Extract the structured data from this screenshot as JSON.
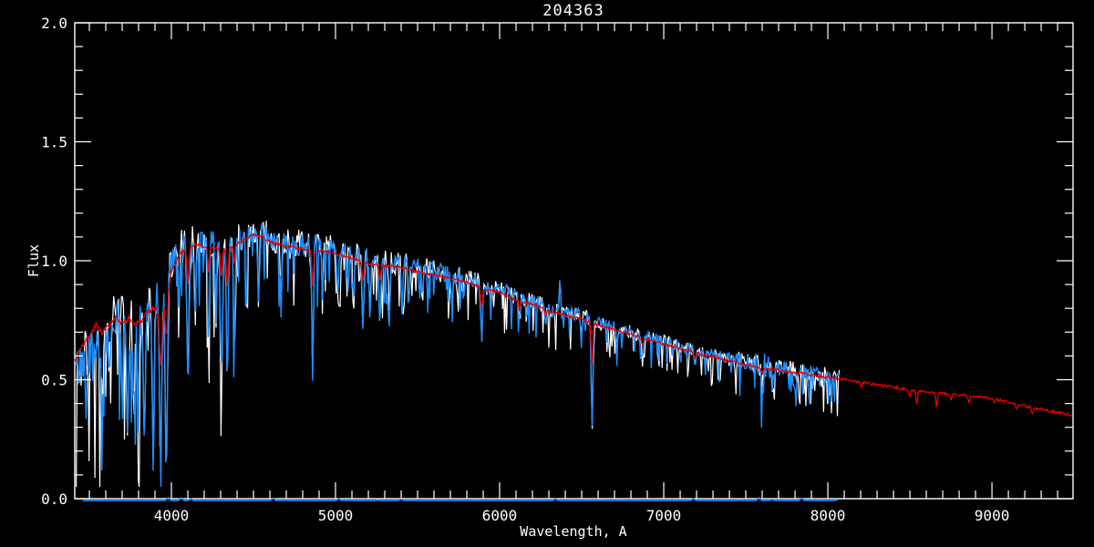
{
  "page": {
    "background": "#000000",
    "foreground": "#ffffff"
  },
  "chart_data": {
    "type": "line",
    "title": "204363",
    "xlabel": "Wavelength, A",
    "ylabel": "Flux",
    "xlim": [
      3411,
      9494
    ],
    "ylim": [
      0.0,
      2.0
    ],
    "grid": false,
    "axis_color": "#ffffff",
    "x_major_ticks": [
      {
        "value": 4000,
        "label": "4000"
      },
      {
        "value": 5000,
        "label": "5000"
      },
      {
        "value": 6000,
        "label": "6000"
      },
      {
        "value": 7000,
        "label": "7000"
      },
      {
        "value": 8000,
        "label": "8000"
      },
      {
        "value": 9000,
        "label": "9000"
      }
    ],
    "y_major_ticks": [
      {
        "value": 0.0,
        "label": "0.0"
      },
      {
        "value": 0.5,
        "label": "0.5"
      },
      {
        "value": 1.0,
        "label": "1.0"
      },
      {
        "value": 1.5,
        "label": "1.5"
      },
      {
        "value": 2.0,
        "label": "2.0"
      }
    ],
    "x_minor_step": 100,
    "y_minor_step": 0.1,
    "observed": {
      "color": "#1e8fff",
      "underlay_color": "#ffffff",
      "range": [
        3420,
        8070
      ],
      "continuum": [
        [
          3420,
          0.54
        ],
        [
          3450,
          0.56
        ],
        [
          3500,
          0.62
        ],
        [
          3550,
          0.66
        ],
        [
          3600,
          0.7
        ],
        [
          3650,
          0.74
        ],
        [
          3700,
          0.73
        ],
        [
          3750,
          0.75
        ],
        [
          3800,
          0.74
        ],
        [
          3850,
          0.8
        ],
        [
          3900,
          0.83
        ],
        [
          3950,
          0.85
        ],
        [
          4000,
          0.98
        ],
        [
          4050,
          1.05
        ],
        [
          4100,
          1.07
        ],
        [
          4150,
          1.09
        ],
        [
          4200,
          1.08
        ],
        [
          4250,
          1.07
        ],
        [
          4300,
          1.08
        ],
        [
          4350,
          1.07
        ],
        [
          4400,
          1.09
        ],
        [
          4450,
          1.11
        ],
        [
          4500,
          1.13
        ],
        [
          4550,
          1.12
        ],
        [
          4600,
          1.1
        ],
        [
          4700,
          1.08
        ],
        [
          4800,
          1.07
        ],
        [
          4900,
          1.06
        ],
        [
          5000,
          1.05
        ],
        [
          5100,
          1.03
        ],
        [
          5200,
          1.01
        ],
        [
          5300,
          1.0
        ],
        [
          5400,
          0.99
        ],
        [
          5500,
          0.97
        ],
        [
          5600,
          0.96
        ],
        [
          5700,
          0.94
        ],
        [
          5800,
          0.93
        ],
        [
          5900,
          0.9
        ],
        [
          6000,
          0.88
        ],
        [
          6100,
          0.85
        ],
        [
          6200,
          0.83
        ],
        [
          6300,
          0.8
        ],
        [
          6400,
          0.78
        ],
        [
          6500,
          0.77
        ],
        [
          6600,
          0.74
        ],
        [
          6700,
          0.72
        ],
        [
          6800,
          0.7
        ],
        [
          6900,
          0.68
        ],
        [
          7000,
          0.66
        ],
        [
          7100,
          0.64
        ],
        [
          7200,
          0.62
        ],
        [
          7300,
          0.605
        ],
        [
          7400,
          0.59
        ],
        [
          7500,
          0.575
        ],
        [
          7600,
          0.56
        ],
        [
          7700,
          0.55
        ],
        [
          7800,
          0.54
        ],
        [
          7900,
          0.53
        ],
        [
          8000,
          0.52
        ],
        [
          8070,
          0.515
        ]
      ],
      "absorption_lines": [
        [
          3580,
          12,
          0.35
        ],
        [
          3620,
          8,
          0.3
        ],
        [
          3735,
          10,
          0.6
        ],
        [
          3770,
          8,
          0.55
        ],
        [
          3798,
          8,
          0.5
        ],
        [
          3835,
          8,
          0.72
        ],
        [
          3889,
          8,
          0.78
        ],
        [
          3934,
          10,
          0.85
        ],
        [
          3969,
          10,
          0.8
        ],
        [
          4045,
          6,
          0.3
        ],
        [
          4101,
          9,
          0.55
        ],
        [
          4144,
          6,
          0.3
        ],
        [
          4227,
          6,
          0.45
        ],
        [
          4271,
          6,
          0.35
        ],
        [
          4305,
          10,
          0.5
        ],
        [
          4340,
          8,
          0.55
        ],
        [
          4383,
          7,
          0.45
        ],
        [
          4455,
          6,
          0.3
        ],
        [
          4531,
          6,
          0.3
        ],
        [
          4668,
          6,
          0.3
        ],
        [
          4861,
          7,
          0.55
        ],
        [
          4920,
          6,
          0.25
        ],
        [
          5015,
          6,
          0.2
        ],
        [
          5110,
          6,
          0.2
        ],
        [
          5167,
          8,
          0.32
        ],
        [
          5210,
          6,
          0.25
        ],
        [
          5270,
          8,
          0.3
        ],
        [
          5328,
          6,
          0.25
        ],
        [
          5404,
          6,
          0.2
        ],
        [
          5446,
          6,
          0.2
        ],
        [
          5530,
          6,
          0.15
        ],
        [
          5711,
          6,
          0.12
        ],
        [
          5782,
          6,
          0.1
        ],
        [
          5890,
          9,
          0.25
        ],
        [
          6122,
          6,
          0.12
        ],
        [
          6162,
          6,
          0.12
        ],
        [
          6280,
          6,
          0.1
        ],
        [
          6495,
          6,
          0.12
        ],
        [
          6563,
          7,
          0.62
        ],
        [
          6717,
          6,
          0.1
        ],
        [
          6870,
          9,
          0.15
        ],
        [
          7190,
          8,
          0.08
        ],
        [
          7600,
          10,
          0.18
        ],
        [
          7665,
          8,
          0.12
        ]
      ],
      "cosmic_spikes": [
        [
          6368,
          4,
          -0.26
        ],
        [
          7612,
          4,
          -0.16
        ]
      ],
      "noise_profile": [
        [
          3420,
          0.105
        ],
        [
          3550,
          0.095
        ],
        [
          3700,
          0.1
        ],
        [
          3850,
          0.1
        ],
        [
          3950,
          0.09
        ],
        [
          4050,
          0.07
        ],
        [
          4200,
          0.06
        ],
        [
          4400,
          0.055
        ],
        [
          4600,
          0.05
        ],
        [
          4800,
          0.05
        ],
        [
          5000,
          0.045
        ],
        [
          5200,
          0.042
        ],
        [
          5400,
          0.04
        ],
        [
          5600,
          0.038
        ],
        [
          5800,
          0.035
        ],
        [
          6000,
          0.032
        ],
        [
          6200,
          0.03
        ],
        [
          6400,
          0.028
        ],
        [
          6600,
          0.027
        ],
        [
          6800,
          0.026
        ],
        [
          7000,
          0.025
        ],
        [
          7200,
          0.024
        ],
        [
          7400,
          0.024
        ],
        [
          7520,
          0.04
        ],
        [
          7620,
          0.05
        ],
        [
          7680,
          0.035
        ],
        [
          7800,
          0.028
        ],
        [
          7950,
          0.03
        ],
        [
          8070,
          0.035
        ]
      ],
      "down_spike_probability": 0.15,
      "seeds": {
        "white": 7,
        "blue": 42
      },
      "underlay_noise_scale": 1.2
    },
    "model": {
      "color": "#e60000",
      "range": [
        3411,
        9490
      ],
      "anchors": [
        [
          3411,
          0.58
        ],
        [
          3450,
          0.64
        ],
        [
          3500,
          0.68
        ],
        [
          3540,
          0.73
        ],
        [
          3580,
          0.7
        ],
        [
          3620,
          0.73
        ],
        [
          3660,
          0.76
        ],
        [
          3700,
          0.73
        ],
        [
          3740,
          0.76
        ],
        [
          3780,
          0.73
        ],
        [
          3820,
          0.75
        ],
        [
          3860,
          0.78
        ],
        [
          3900,
          0.8
        ],
        [
          3950,
          0.82
        ],
        [
          4000,
          0.95
        ],
        [
          4050,
          1.03
        ],
        [
          4100,
          1.05
        ],
        [
          4150,
          1.07
        ],
        [
          4200,
          1.06
        ],
        [
          4250,
          1.05
        ],
        [
          4300,
          1.06
        ],
        [
          4350,
          1.05
        ],
        [
          4400,
          1.07
        ],
        [
          4450,
          1.09
        ],
        [
          4500,
          1.11
        ],
        [
          4550,
          1.1
        ],
        [
          4600,
          1.08
        ],
        [
          4700,
          1.06
        ],
        [
          4800,
          1.05
        ],
        [
          4900,
          1.04
        ],
        [
          5000,
          1.03
        ],
        [
          5100,
          1.01
        ],
        [
          5200,
          0.99
        ],
        [
          5300,
          0.98
        ],
        [
          5400,
          0.97
        ],
        [
          5500,
          0.955
        ],
        [
          5600,
          0.94
        ],
        [
          5700,
          0.925
        ],
        [
          5800,
          0.91
        ],
        [
          5900,
          0.885
        ],
        [
          6000,
          0.865
        ],
        [
          6100,
          0.835
        ],
        [
          6200,
          0.815
        ],
        [
          6300,
          0.79
        ],
        [
          6400,
          0.77
        ],
        [
          6500,
          0.755
        ],
        [
          6600,
          0.73
        ],
        [
          6700,
          0.71
        ],
        [
          6800,
          0.69
        ],
        [
          6900,
          0.67
        ],
        [
          7000,
          0.65
        ],
        [
          7100,
          0.63
        ],
        [
          7200,
          0.61
        ],
        [
          7300,
          0.595
        ],
        [
          7400,
          0.58
        ],
        [
          7500,
          0.565
        ],
        [
          7600,
          0.55
        ],
        [
          7700,
          0.54
        ],
        [
          7800,
          0.53
        ],
        [
          7900,
          0.52
        ],
        [
          8000,
          0.51
        ],
        [
          8100,
          0.5
        ],
        [
          8200,
          0.49
        ],
        [
          8300,
          0.478
        ],
        [
          8400,
          0.468
        ],
        [
          8500,
          0.458
        ],
        [
          8600,
          0.45
        ],
        [
          8700,
          0.442
        ],
        [
          8800,
          0.436
        ],
        [
          8900,
          0.43
        ],
        [
          9000,
          0.42
        ],
        [
          9100,
          0.405
        ],
        [
          9200,
          0.39
        ],
        [
          9300,
          0.375
        ],
        [
          9400,
          0.362
        ],
        [
          9490,
          0.35
        ]
      ],
      "absorption_lines": [
        [
          3935,
          12,
          0.3
        ],
        [
          3970,
          10,
          0.22
        ],
        [
          4101,
          8,
          0.14
        ],
        [
          4227,
          6,
          0.1
        ],
        [
          4305,
          9,
          0.12
        ],
        [
          4340,
          8,
          0.15
        ],
        [
          4383,
          6,
          0.08
        ],
        [
          4861,
          7,
          0.14
        ],
        [
          5167,
          8,
          0.08
        ],
        [
          5270,
          7,
          0.06
        ],
        [
          5890,
          8,
          0.1
        ],
        [
          6122,
          6,
          0.05
        ],
        [
          6280,
          6,
          0.04
        ],
        [
          6563,
          7,
          0.25
        ],
        [
          6870,
          8,
          0.05
        ],
        [
          7190,
          7,
          0.04
        ],
        [
          7600,
          8,
          0.05
        ],
        [
          8205,
          7,
          0.05
        ],
        [
          8498,
          6,
          0.07
        ],
        [
          8542,
          6,
          0.14
        ],
        [
          8662,
          6,
          0.14
        ],
        [
          8750,
          6,
          0.05
        ],
        [
          8860,
          7,
          0.06
        ],
        [
          9015,
          7,
          0.05
        ],
        [
          9150,
          8,
          0.04
        ],
        [
          9245,
          7,
          0.06
        ]
      ],
      "wiggle_amp_blue_end": 0.012,
      "wiggle_amp": 0.006,
      "seed": 3
    },
    "noise_floor": {
      "color": "#1e8fff",
      "range": [
        3460,
        8070
      ],
      "flux": -0.008,
      "seed": 9
    }
  }
}
